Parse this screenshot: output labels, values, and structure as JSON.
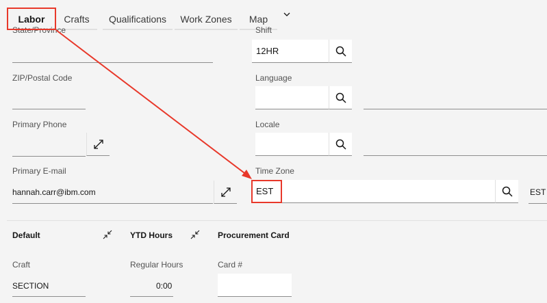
{
  "tabs": [
    {
      "label": "Labor"
    },
    {
      "label": "Crafts"
    },
    {
      "label": "Qualifications"
    },
    {
      "label": "Work Zones"
    },
    {
      "label": "Map"
    }
  ],
  "fields": {
    "state": {
      "label": "State/Province",
      "value": ""
    },
    "shift": {
      "label": "Shift",
      "value": "12HR"
    },
    "zip": {
      "label": "ZIP/Postal Code",
      "value": ""
    },
    "language": {
      "label": "Language",
      "value": ""
    },
    "phone": {
      "label": "Primary Phone",
      "value": ""
    },
    "locale": {
      "label": "Locale",
      "value": ""
    },
    "email": {
      "label": "Primary E-mail",
      "value": "hannah.carr@ibm.com"
    },
    "timezone": {
      "label": "Time Zone",
      "value": "EST",
      "description": "EST ("
    }
  },
  "sections": {
    "default": {
      "title": "Default",
      "craft_label": "Craft",
      "craft_value": "SECTION"
    },
    "ytd": {
      "title": "YTD Hours",
      "regular_label": "Regular Hours",
      "regular_value": "0:00"
    },
    "procurement": {
      "title": "Procurement Card",
      "card_label": "Card #",
      "card_value": ""
    }
  },
  "icons": {
    "search": "search-icon",
    "expand": "expand-icon",
    "collapse": "collapse-icon",
    "more": "chevron-down-icon"
  },
  "colors": {
    "annotation_red": "#e8382a",
    "background": "#f4f4f4"
  }
}
